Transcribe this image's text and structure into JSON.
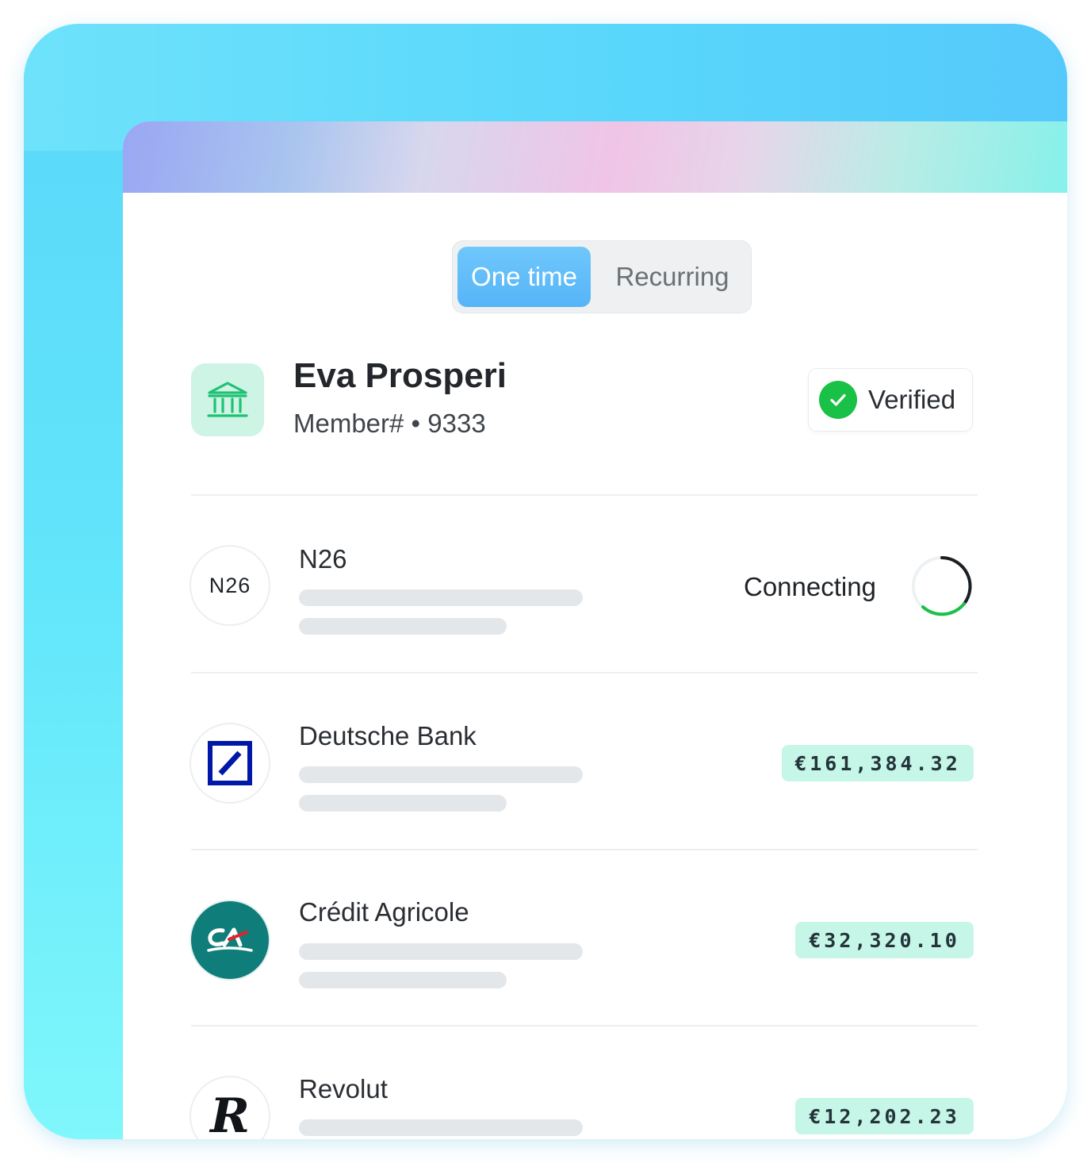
{
  "payment_type": {
    "options": [
      {
        "label": "One time",
        "active": true
      },
      {
        "label": "Recurring",
        "active": false
      }
    ]
  },
  "account": {
    "icon": "bank-building-icon",
    "name": "Eva Prosperi",
    "member_line": "Member# • 9333",
    "status": "Verified",
    "status_color": "#19c146"
  },
  "banks": [
    {
      "name": "N26",
      "logo_text": "N26",
      "status": "Connecting",
      "amount": null
    },
    {
      "name": "Deutsche Bank",
      "logo_text": "",
      "amount": "€161,384.32"
    },
    {
      "name": "Crédit Agricole",
      "logo_text": "",
      "amount": "€32,320.10"
    },
    {
      "name": "Revolut",
      "logo_text": "R",
      "amount": "€12,202.23"
    }
  ],
  "colors": {
    "accent_blue": "#56b4f7",
    "amount_badge_bg": "#c6f6e7",
    "spinner_green": "#19c146",
    "credit_agricole_teal": "#0f7d7a",
    "deutsche_blue": "#0018a8"
  }
}
